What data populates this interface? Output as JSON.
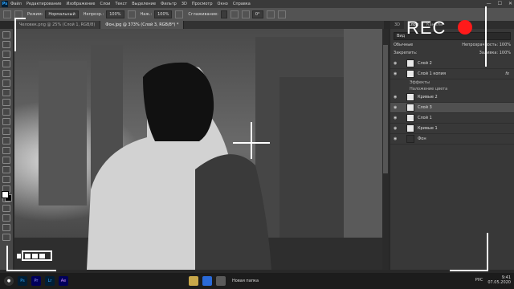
{
  "app": {
    "icon_label": "Ps",
    "menu": [
      "Файл",
      "Редактирование",
      "Изображение",
      "Слои",
      "Текст",
      "Выделение",
      "Фильтр",
      "3D",
      "Просмотр",
      "Окно",
      "Справка"
    ],
    "window_controls": [
      "—",
      "☐",
      "✕"
    ]
  },
  "options_bar": {
    "mode_label": "Режим:",
    "mode_value": "Нормальный",
    "opacity_label": "Непрозр.:",
    "opacity_value": "100%",
    "pressure_label": "Наж.:",
    "pressure_value": "100%",
    "smoothing_label": "Сглаживание:",
    "smoothing_value": "",
    "angle_value": "0°"
  },
  "tabs": [
    {
      "label": "Человек.png @ 25% (Слой 1, RGB/8)",
      "active": false
    },
    {
      "label": "Фон.jpg @ 373% (Слой 3, RGB/8*) *",
      "active": true
    }
  ],
  "layers_panel": {
    "tabs": [
      "3D",
      "Слои",
      "Каналы"
    ],
    "search_placeholder": "Вид",
    "blend_mode": "Обычные",
    "opacity_label": "Непрозрачность:",
    "opacity_value": "100%",
    "lock_label": "Закрепить:",
    "fill_label": "Заливка:",
    "fill_value": "100%",
    "layers": [
      {
        "name": "Слой 2",
        "type": "layer",
        "selected": false,
        "thumb": "light"
      },
      {
        "name": "Слой 1 копия",
        "type": "layer",
        "selected": false,
        "thumb": "light",
        "fx": "fx"
      },
      {
        "name": "Эффекты",
        "type": "effect"
      },
      {
        "name": "Наложение цвета",
        "type": "effect"
      },
      {
        "name": "Кривые 2",
        "type": "adjustment",
        "selected": false,
        "thumb": "light"
      },
      {
        "name": "Слой 3",
        "type": "layer",
        "selected": true,
        "thumb": "light"
      },
      {
        "name": "Слой 1",
        "type": "layer",
        "selected": false,
        "thumb": "light"
      },
      {
        "name": "Кривые 1",
        "type": "adjustment",
        "selected": false,
        "thumb": "light"
      },
      {
        "name": "Фон",
        "type": "layer",
        "selected": false,
        "thumb": "dark"
      }
    ]
  },
  "taskbar": {
    "apps": [
      "Ps",
      "Pr",
      "Lr",
      "Ae"
    ],
    "folder_label": "Новая папка",
    "lang": "РУС",
    "time": "9:41",
    "date": "07.05.2020"
  },
  "overlay": {
    "rec_text": "REC",
    "rec_color": "#ff1a1a"
  }
}
